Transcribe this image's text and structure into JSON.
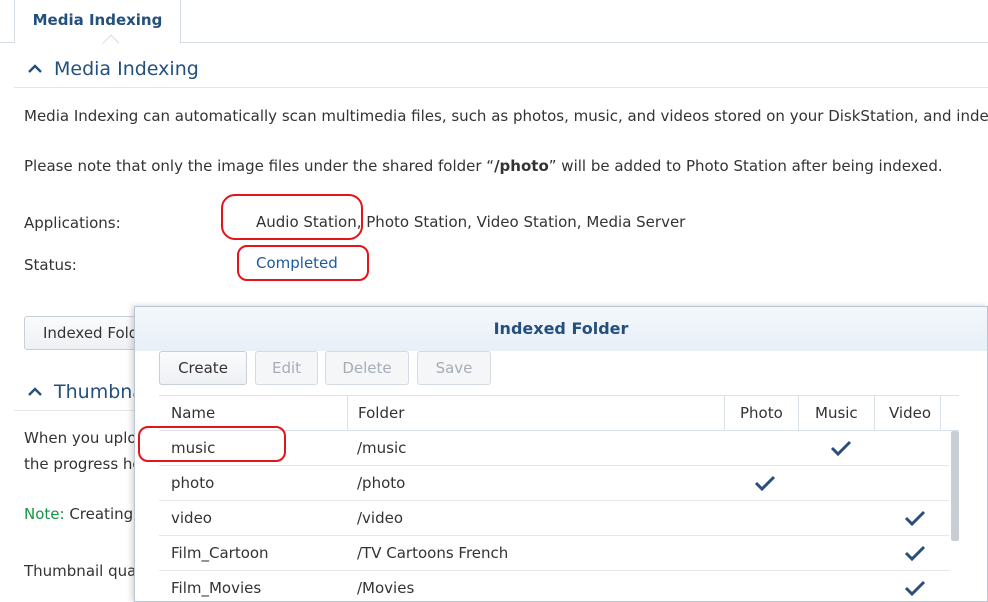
{
  "tab": {
    "label": "Media Indexing"
  },
  "media_section": {
    "title": "Media Indexing",
    "description": "Media Indexing can automatically scan multimedia files, such as photos, music, and videos stored on your DiskStation, and index t",
    "note_prefix": "Please note that only the image files under the shared folder “",
    "note_folder": "/photo",
    "note_suffix": "” will be added to Photo Station after being indexed.",
    "applications_label": "Applications:",
    "applications_value": "Audio Station, Photo Station, Video Station, Media Server",
    "status_label": "Status:",
    "status_value": "Completed",
    "indexed_folder_button": "Indexed Folder"
  },
  "thumbnail_section": {
    "title": "Thumbnail",
    "line1": "When you upload",
    "line1_right": "x",
    "line2": "the progress he",
    "note_label": "Note:",
    "note_text": " Creating",
    "quality_text": "Thumbnail qual"
  },
  "dialog": {
    "title": "Indexed Folder",
    "toolbar": {
      "create": "Create",
      "edit": "Edit",
      "delete": "Delete",
      "save": "Save"
    },
    "columns": {
      "name": "Name",
      "folder": "Folder",
      "photo": "Photo",
      "music": "Music",
      "video": "Video"
    },
    "rows": [
      {
        "name": "music",
        "folder": "/music",
        "photo": false,
        "music": true,
        "video": false
      },
      {
        "name": "photo",
        "folder": "/photo",
        "photo": true,
        "music": false,
        "video": false
      },
      {
        "name": "video",
        "folder": "/video",
        "photo": false,
        "music": false,
        "video": true
      },
      {
        "name": "Film_Cartoon",
        "folder": "/TV Cartoons French",
        "photo": false,
        "music": false,
        "video": true
      },
      {
        "name": "Film_Movies",
        "folder": "/Movies",
        "photo": false,
        "music": false,
        "video": true
      }
    ]
  },
  "colors": {
    "accent": "#24507f",
    "link": "#1f5aa0",
    "annotation": "#e3141b",
    "check": "#2a4f7d",
    "note": "#169642"
  }
}
